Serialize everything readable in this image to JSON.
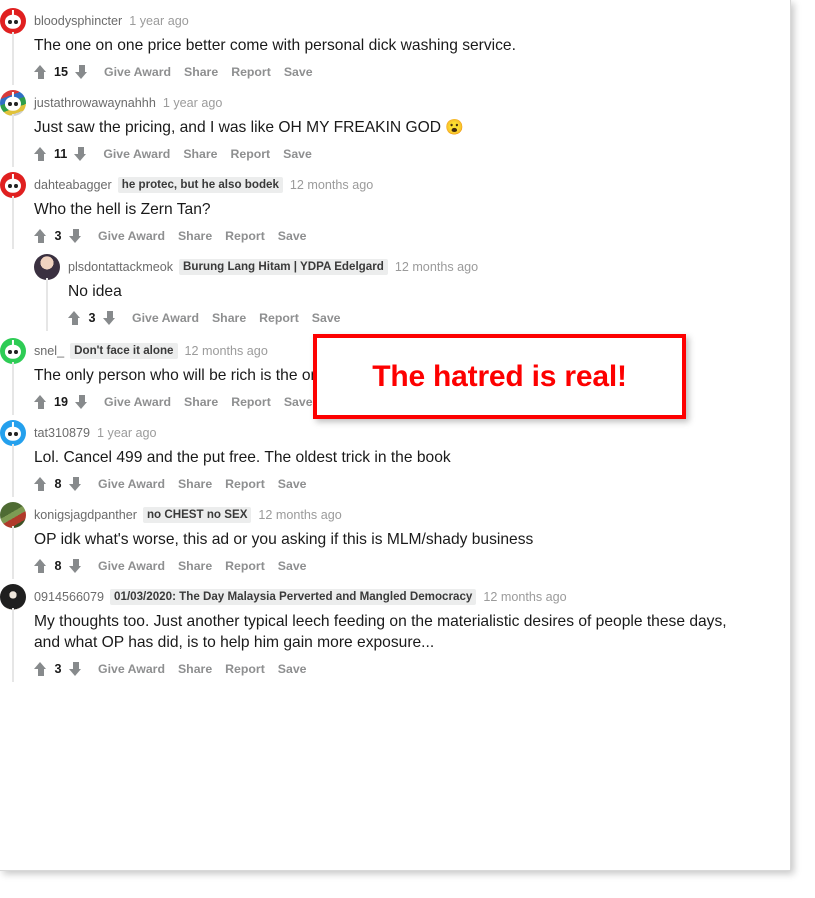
{
  "annotation": {
    "text": "The hatred is real!",
    "border_color": "#fd0000",
    "text_color": "#fd0000"
  },
  "actions": {
    "give_award": "Give Award",
    "share": "Share",
    "report": "Report",
    "save": "Save"
  },
  "comments": [
    {
      "username": "bloodysphincter",
      "flair": "",
      "time": "1 year ago",
      "body": "The one on one price better come with personal dick washing service.",
      "score": "15",
      "avatar_color": "#e02020",
      "avatar_kind": "snoo-red",
      "depth": 0
    },
    {
      "username": "justathrowawaynahhh",
      "flair": "",
      "time": "1 year ago",
      "body": "Just saw the pricing, and I was like OH MY FREAKIN GOD ",
      "emoji": "😮",
      "score": "11",
      "avatar_color": "#2d8a3e",
      "avatar_kind": "snoo-multi",
      "depth": 0
    },
    {
      "username": "dahteabagger",
      "flair": "he protec, but he also bodek",
      "time": "12 months ago",
      "body": "Who the hell is Zern Tan?",
      "score": "3",
      "avatar_color": "#e02020",
      "avatar_kind": "snoo-red",
      "depth": 0
    },
    {
      "username": "plsdontattackmeok",
      "flair": "Burung Lang Hitam | YDPA Edelgard",
      "time": "12 months ago",
      "body": "No idea",
      "score": "3",
      "avatar_color": "#4c4352",
      "avatar_kind": "photo-anime",
      "depth": 1
    },
    {
      "username": "snel_",
      "flair": "Don't face it alone",
      "time": "12 months ago",
      "body": "The only person who will be rich is the one telling you how to be rich.",
      "score": "19",
      "avatar_color": "#2ecc55",
      "avatar_kind": "snoo-green",
      "depth": 0
    },
    {
      "username": "tat310879",
      "flair": "",
      "time": "1 year ago",
      "body": "Lol. Cancel 499 and the put free. The oldest trick in the book",
      "score": "8",
      "avatar_color": "#24a0ed",
      "avatar_kind": "snoo-blue",
      "depth": 0
    },
    {
      "username": "konigsjagdpanther",
      "flair": "no CHEST no SEX",
      "time": "12 months ago",
      "body": "OP idk what's worse, this ad or you asking if this is MLM/shady business",
      "score": "8",
      "avatar_color": "#5a7040",
      "avatar_kind": "photo-green",
      "depth": 0
    },
    {
      "username": "0914566079",
      "flair": "01/03/2020: The Day Malaysia Perverted and Mangled Democracy",
      "time": "12 months ago",
      "body": "My thoughts too. Just another typical leech feeding on the materialistic desires of people these days, and what OP has did, is to help him gain more exposure...",
      "score": "3",
      "avatar_color": "#2b2b2b",
      "avatar_kind": "photo-dark",
      "depth": 0
    }
  ]
}
